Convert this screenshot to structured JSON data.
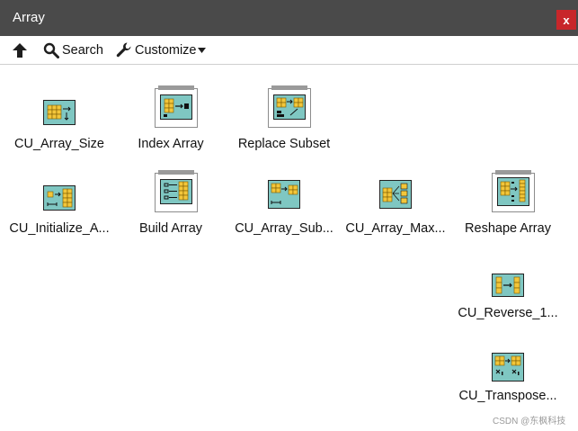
{
  "window": {
    "title": "Array",
    "close_label": "x"
  },
  "toolbar": {
    "up_icon": "up-arrow-icon",
    "search_label": "Search",
    "search_icon": "magnifier-icon",
    "customize_label": "Customize",
    "customize_icon": "wrench-icon",
    "customize_dropdown_icon": "triangle-down-icon"
  },
  "palette": {
    "items": [
      {
        "label": "CU_Array_Size",
        "kind": "vi"
      },
      {
        "label": "Index Array",
        "kind": "primitive"
      },
      {
        "label": "Replace Subset",
        "kind": "primitive"
      },
      {
        "label": "CU_Initialize_A...",
        "kind": "vi"
      },
      {
        "label": "Build Array",
        "kind": "primitive"
      },
      {
        "label": "CU_Array_Sub...",
        "kind": "vi"
      },
      {
        "label": "CU_Array_Max...",
        "kind": "vi"
      },
      {
        "label": "Reshape Array",
        "kind": "primitive"
      },
      {
        "label": "CU_Reverse_1...",
        "kind": "vi"
      },
      {
        "label": "CU_Transpose...",
        "kind": "vi"
      }
    ]
  },
  "watermark": "CSDN @东枫科技",
  "colors": {
    "titlebar": "#4a4a4a",
    "close": "#c8262a",
    "icon_teal": "#7fc7c2",
    "array_cell": "#f3c63a"
  }
}
